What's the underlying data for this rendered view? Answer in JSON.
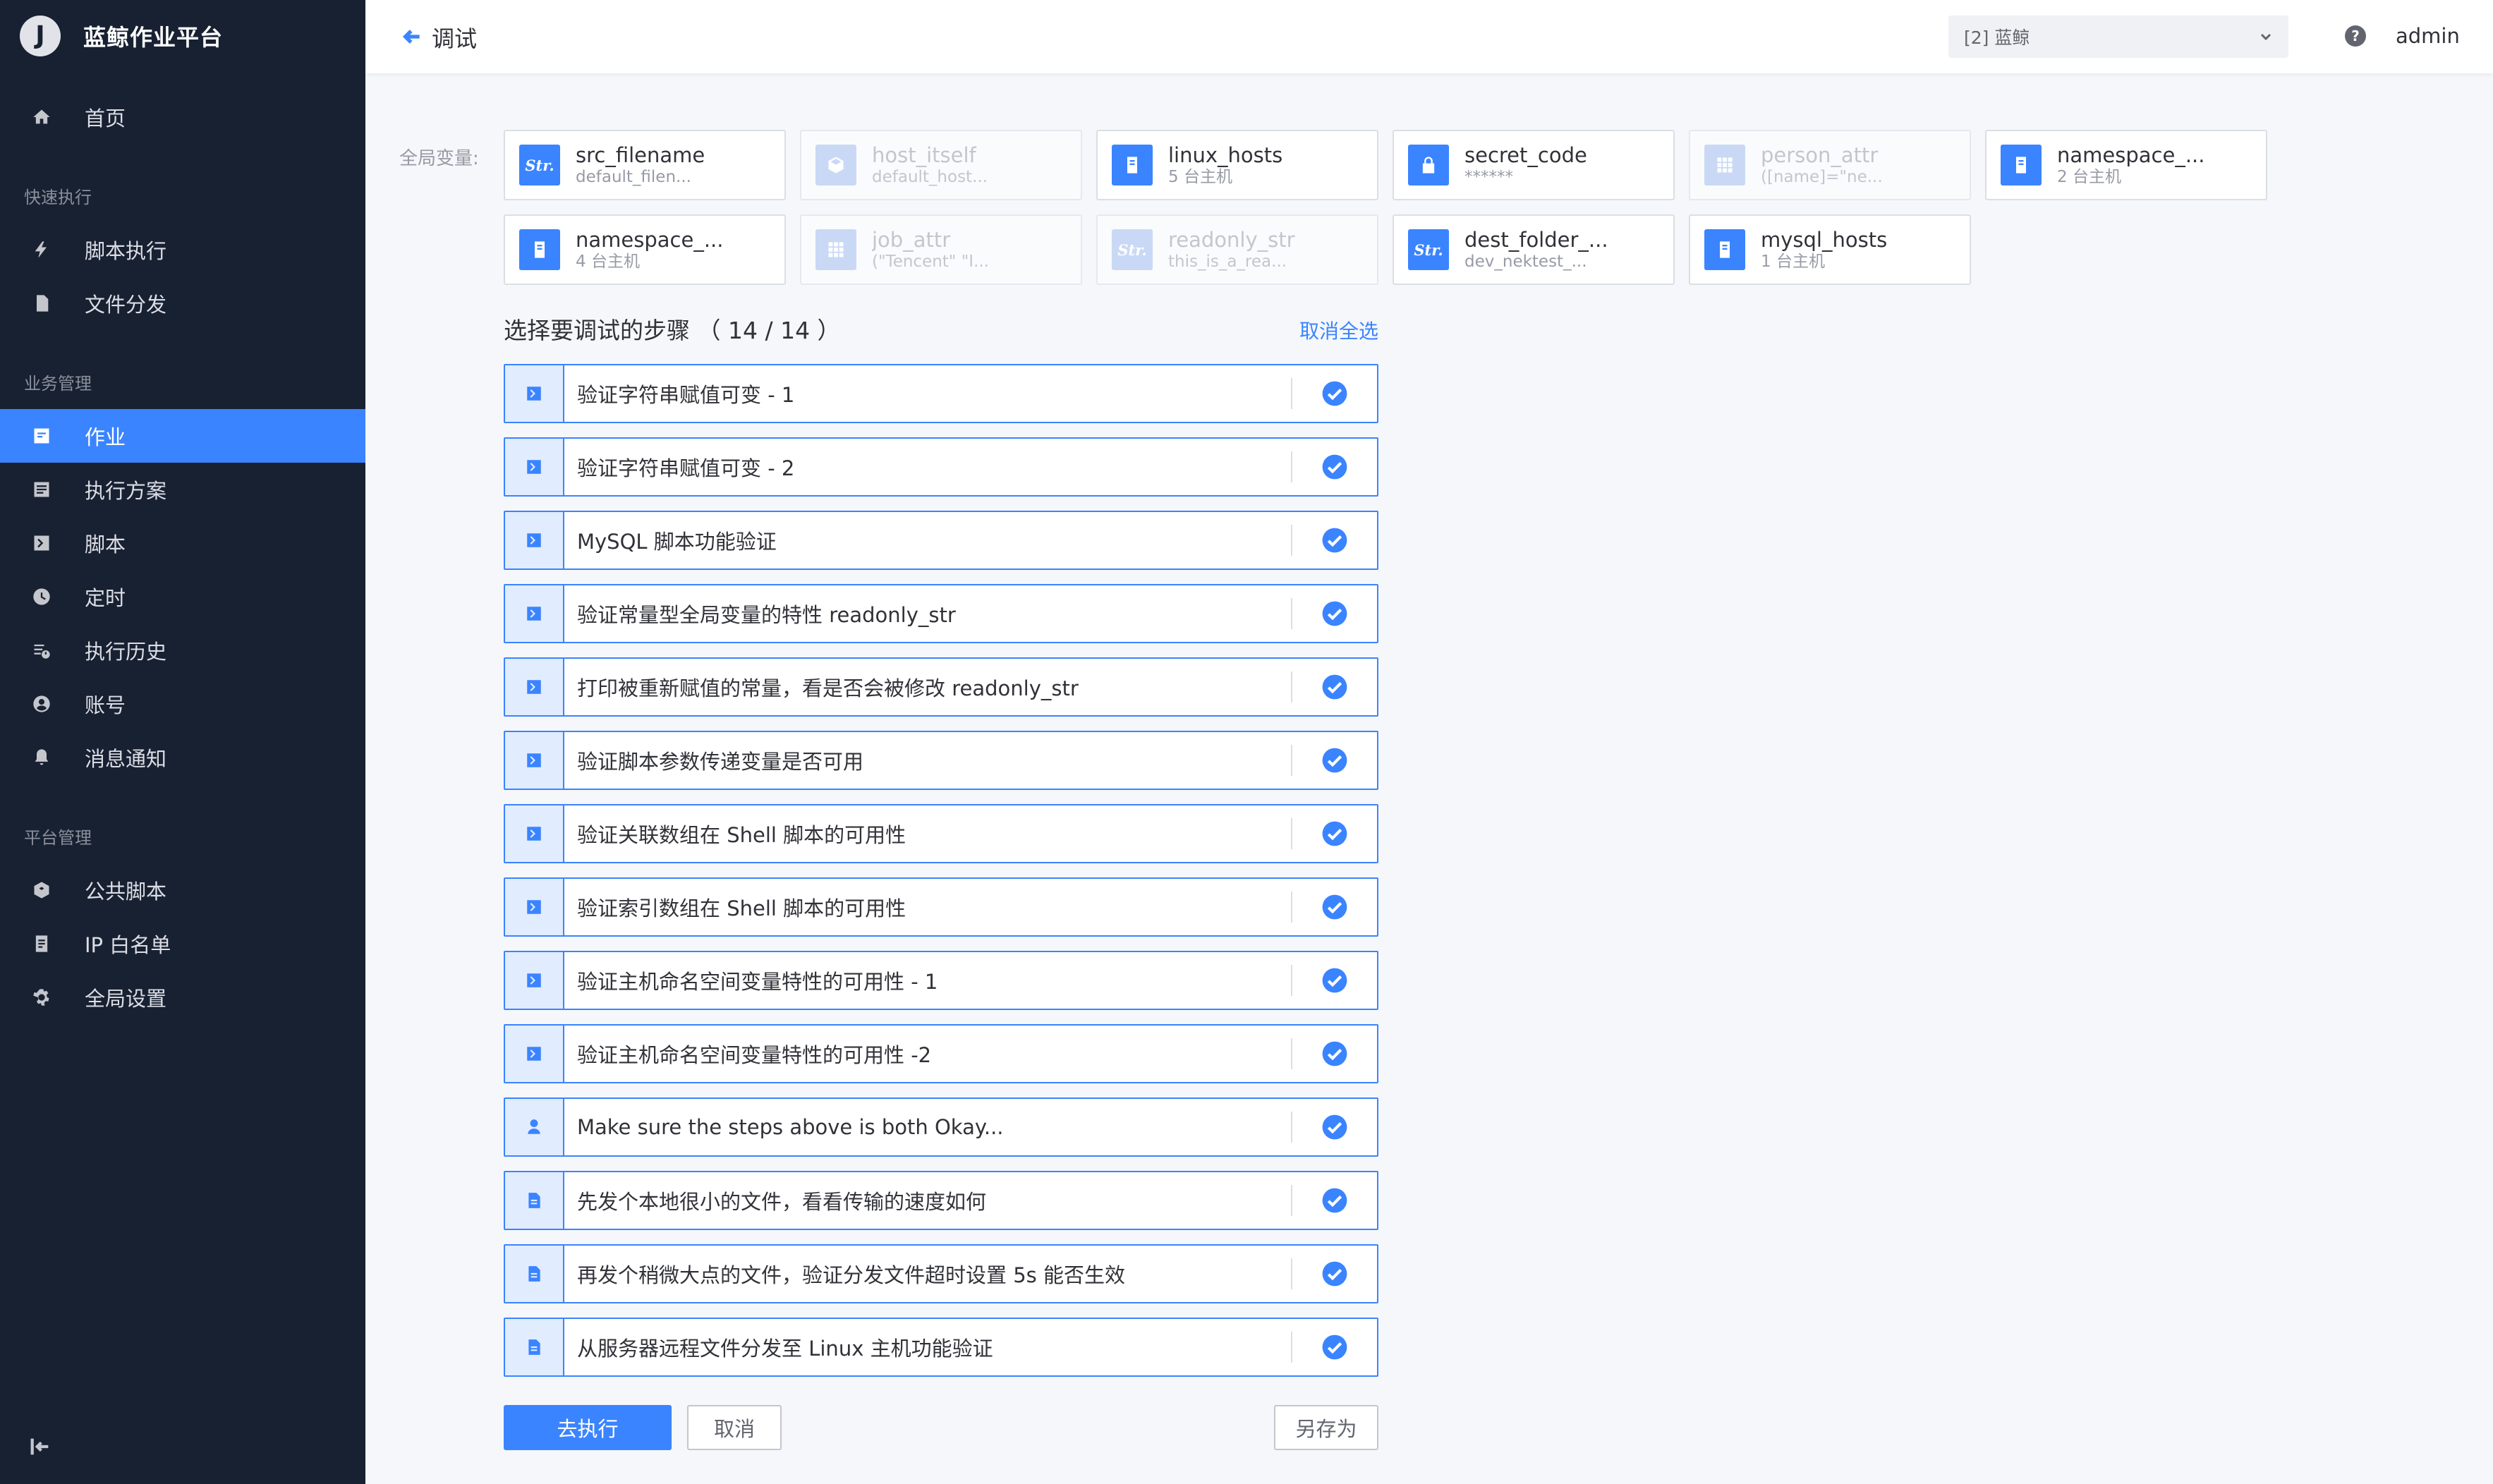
{
  "app": {
    "logo_letter": "J",
    "name": "蓝鲸作业平台"
  },
  "sidebar": {
    "home": {
      "label": "首页",
      "icon": "home-icon"
    },
    "groups": [
      {
        "title": "快速执行"
      },
      {
        "title": "业务管理"
      },
      {
        "title": "平台管理"
      }
    ],
    "items": [
      {
        "label": "脚本执行",
        "icon": "lightning-icon"
      },
      {
        "label": "文件分发",
        "icon": "file-icon"
      },
      {
        "label": "作业",
        "icon": "job-icon",
        "active": true
      },
      {
        "label": "执行方案",
        "icon": "list-icon"
      },
      {
        "label": "脚本",
        "icon": "terminal-icon"
      },
      {
        "label": "定时",
        "icon": "clock-icon"
      },
      {
        "label": "执行历史",
        "icon": "history-icon"
      },
      {
        "label": "账号",
        "icon": "account-icon"
      },
      {
        "label": "消息通知",
        "icon": "bell-icon"
      },
      {
        "label": "公共脚本",
        "icon": "hexagon-icon"
      },
      {
        "label": "IP 白名单",
        "icon": "whitelist-icon"
      },
      {
        "label": "全局设置",
        "icon": "gear-icon"
      }
    ]
  },
  "header": {
    "title": "调试",
    "business_select": "[2] 蓝鲸",
    "help": "?",
    "user": "admin"
  },
  "global_vars": {
    "label": "全局变量:",
    "items": [
      {
        "name": "src_filename",
        "sub": "default_filen...",
        "type": "string",
        "disabled": false
      },
      {
        "name": "host_itself",
        "sub": "default_host...",
        "type": "cube",
        "disabled": true
      },
      {
        "name": "linux_hosts",
        "sub": "5 台主机",
        "type": "host",
        "disabled": false
      },
      {
        "name": "secret_code",
        "sub": "******",
        "type": "lock",
        "disabled": false
      },
      {
        "name": "person_attr",
        "sub": "([name]=\"ne...",
        "type": "grid",
        "disabled": true
      },
      {
        "name": "namespace_...",
        "sub": "2 台主机",
        "type": "host",
        "disabled": false
      },
      {
        "name": "namespace_...",
        "sub": "4 台主机",
        "type": "host",
        "disabled": false
      },
      {
        "name": "job_attr",
        "sub": "(\"Tencent\" \"I...",
        "type": "grid",
        "disabled": true
      },
      {
        "name": "readonly_str",
        "sub": "this_is_a_rea...",
        "type": "string",
        "disabled": true
      },
      {
        "name": "dest_folder_...",
        "sub": "dev_nektest_...",
        "type": "string",
        "disabled": false
      },
      {
        "name": "mysql_hosts",
        "sub": "1 台主机",
        "type": "host",
        "disabled": false
      }
    ]
  },
  "steps_section": {
    "title": "选择要调试的步骤 （ 14 / 14 ）",
    "deselect_all": "取消全选",
    "steps": [
      {
        "type": "script",
        "name": "验证字符串赋值可变 - 1"
      },
      {
        "type": "script",
        "name": "验证字符串赋值可变 - 2"
      },
      {
        "type": "script",
        "name": "MySQL 脚本功能验证"
      },
      {
        "type": "script",
        "name": "验证常量型全局变量的特性 readonly_str"
      },
      {
        "type": "script",
        "name": "打印被重新赋值的常量，看是否会被修改 readonly_str"
      },
      {
        "type": "script",
        "name": "验证脚本参数传递变量是否可用"
      },
      {
        "type": "script",
        "name": "验证关联数组在 Shell 脚本的可用性"
      },
      {
        "type": "script",
        "name": "验证索引数组在 Shell 脚本的可用性"
      },
      {
        "type": "script",
        "name": "验证主机命名空间变量特性的可用性 - 1"
      },
      {
        "type": "script",
        "name": "验证主机命名空间变量特性的可用性 -2"
      },
      {
        "type": "approval",
        "name": "Make sure the steps above is both Okay..."
      },
      {
        "type": "file",
        "name": "先发个本地很小的文件，看看传输的速度如何"
      },
      {
        "type": "file",
        "name": "再发个稍微大点的文件，验证分发文件超时设置 5s 能否生效"
      },
      {
        "type": "file",
        "name": "从服务器远程文件分发至 Linux 主机功能验证"
      }
    ]
  },
  "actions": {
    "execute": "去执行",
    "cancel": "取消",
    "save_as": "另存为"
  },
  "colors": {
    "accent": "#3a84ff",
    "sidebar_bg": "#182132"
  }
}
